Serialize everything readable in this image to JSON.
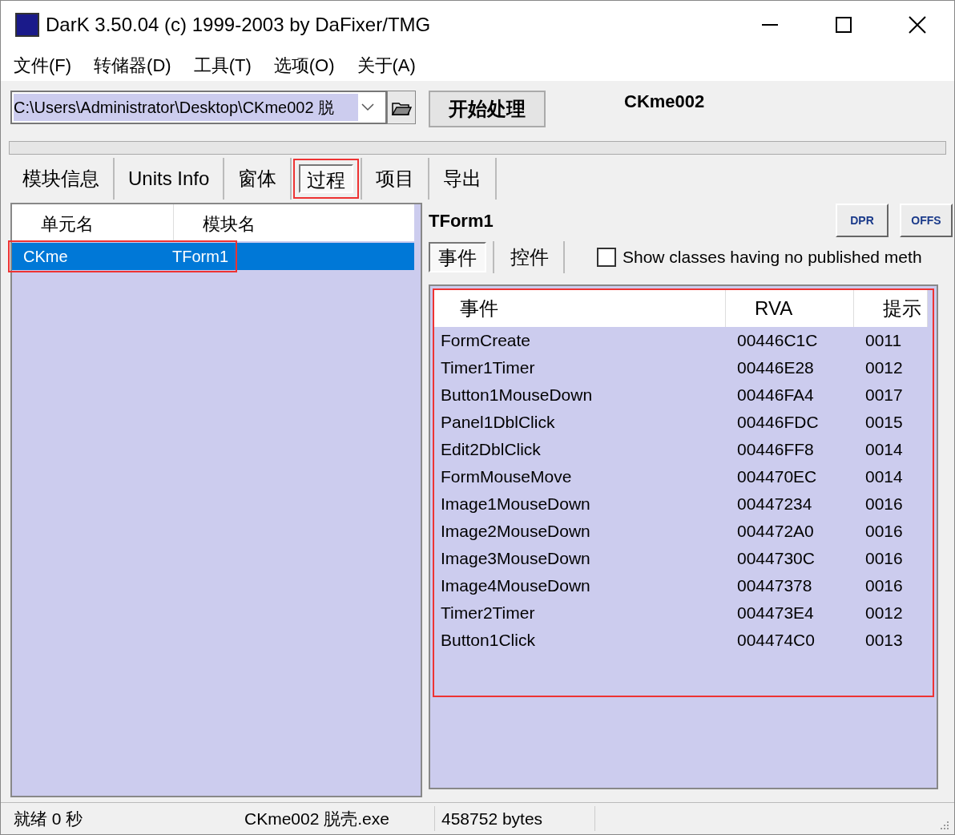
{
  "window": {
    "title": "DarK 3.50.04 (c) 1999-2003 by DaFixer/TMG"
  },
  "menu": [
    "文件(F)",
    "转储器(D)",
    "工具(T)",
    "选项(O)",
    "关于(A)"
  ],
  "toolbar": {
    "path": "C:\\Users\\Administrator\\Desktop\\CKme002 脱",
    "start_button": "开始处理",
    "file_label": "CKme002"
  },
  "progress": {
    "level": 0
  },
  "tabs": [
    {
      "label": "模块信息",
      "selected": false,
      "highlighted": false
    },
    {
      "label": "Units Info",
      "selected": false,
      "highlighted": false
    },
    {
      "label": "窗体",
      "selected": false,
      "highlighted": false
    },
    {
      "label": "过程",
      "selected": true,
      "highlighted": true
    },
    {
      "label": "项目",
      "selected": false,
      "highlighted": false
    },
    {
      "label": "导出",
      "selected": false,
      "highlighted": false
    }
  ],
  "units": {
    "columns": [
      "单元名",
      "模块名"
    ],
    "rows": [
      {
        "unit": "CKme",
        "module": "TForm1",
        "selected": true,
        "highlighted": true
      }
    ]
  },
  "detail": {
    "title": "TForm1",
    "buttons": [
      "DPR",
      "OFFS"
    ],
    "subtabs": [
      {
        "label": "事件",
        "selected": true
      },
      {
        "label": "控件",
        "selected": false
      }
    ],
    "checkbox": {
      "label": "Show classes having no published meth",
      "checked": false
    },
    "events": {
      "highlighted": true,
      "columns": [
        "事件",
        "RVA",
        "提示"
      ],
      "rows": [
        [
          "FormCreate",
          "00446C1C",
          "0011"
        ],
        [
          "Timer1Timer",
          "00446E28",
          "0012"
        ],
        [
          "Button1MouseDown",
          "00446FA4",
          "0017"
        ],
        [
          "Panel1DblClick",
          "00446FDC",
          "0015"
        ],
        [
          "Edit2DblClick",
          "00446FF8",
          "0014"
        ],
        [
          "FormMouseMove",
          "004470EC",
          "0014"
        ],
        [
          "Image1MouseDown",
          "00447234",
          "0016"
        ],
        [
          "Image2MouseDown",
          "004472A0",
          "0016"
        ],
        [
          "Image3MouseDown",
          "0044730C",
          "0016"
        ],
        [
          "Image4MouseDown",
          "00447378",
          "0016"
        ],
        [
          "Timer2Timer",
          "004473E4",
          "0012"
        ],
        [
          "Button1Click",
          "004474C0",
          "0013"
        ]
      ]
    }
  },
  "status_bar": [
    "就绪 0 秒",
    "CKme002 脱壳.exe",
    "458752 bytes"
  ]
}
